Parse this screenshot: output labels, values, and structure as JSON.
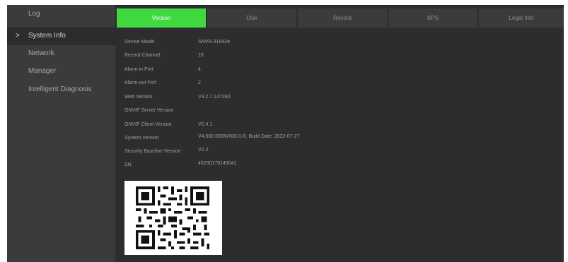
{
  "sidebar": {
    "items": [
      {
        "label": "Log"
      },
      {
        "label": "System Info"
      },
      {
        "label": "Network"
      },
      {
        "label": "Manager"
      },
      {
        "label": "Intelligent Diagnosis"
      }
    ],
    "active_arrow": ">"
  },
  "tabs": [
    {
      "label": "Version"
    },
    {
      "label": "Disk"
    },
    {
      "label": "Record"
    },
    {
      "label": "BPS"
    },
    {
      "label": "Legal Info"
    }
  ],
  "info": [
    {
      "label": "Device Model",
      "value": "SNVR-31642e"
    },
    {
      "label": "Record Channel",
      "value": "16"
    },
    {
      "label": "Alarm-in Port",
      "value": "4"
    },
    {
      "label": "Alarm-out Port",
      "value": "2"
    },
    {
      "label": "Web Version",
      "value": "V3.2.7.147280"
    },
    {
      "label": "ONVIF Server Version",
      "value": ""
    },
    {
      "label": "ONVIF Client Version",
      "value": "V2.4.1"
    },
    {
      "label": "System Version",
      "value": "V4.002.00BW000.0.R, Build Date: 2022-07-27"
    },
    {
      "label": "Security Baseline Version",
      "value": "V2.2"
    },
    {
      "label": "SN",
      "value": "45230179149041"
    }
  ],
  "colors": {
    "accent": "#3fd83f",
    "panel_bg": "#2c2d2f",
    "sidebar_bg": "#3a3b3d",
    "text": "#a0a0a0"
  },
  "icons": {
    "qr": "qr-code"
  }
}
